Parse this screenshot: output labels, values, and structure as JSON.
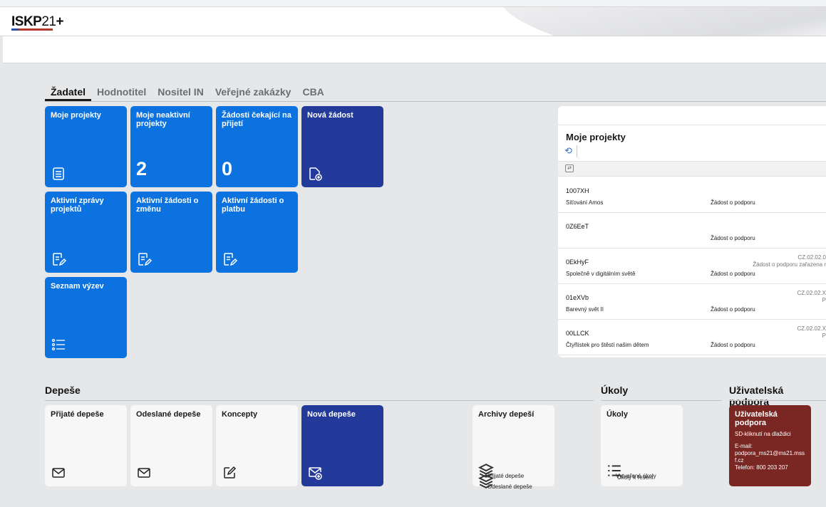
{
  "app": {
    "logo_bold": "ISKP",
    "logo_light": "21",
    "logo_plus": "+"
  },
  "tabs": [
    "Žadatel",
    "Hodnotitel",
    "Nositel IN",
    "Veřejné zakázky",
    "CBA"
  ],
  "tiles": {
    "moje_projekty": "Moje projekty",
    "moje_neaktivni": "Moje neaktivní projekty",
    "moje_neaktivni_count": "2",
    "zadosti_cekajici": "Žádosti čekající na přijetí",
    "zadosti_cekajici_count": "0",
    "nova_zadost": "Nová žádost",
    "aktivni_zpravy": "Aktivní zprávy projektů",
    "aktivni_zmena": "Aktivní žádosti o změnu",
    "aktivni_platba": "Aktivní žádosti o platbu",
    "seznam_vyzev": "Seznam výzev"
  },
  "panel": {
    "title": "Moje projekty",
    "rows": [
      {
        "code": "1007XH",
        "name": "Síťování Amos",
        "type": "Žádost o podporu",
        "reg": "",
        "status": ""
      },
      {
        "code": "0Z6EeT",
        "name": "",
        "type": "Žádost o podporu",
        "reg": "",
        "status": ""
      },
      {
        "code": "0EkHyF",
        "name": "Společně v digitálním světě",
        "type": "Žádost o podporu",
        "reg": "CZ.02.02.0",
        "status": "Žádost o podporu zařazena r"
      },
      {
        "code": "01eXVb",
        "name": "Barevný svět II",
        "type": "Žádost o podporu",
        "reg": "CZ.02.02.X",
        "status": "P"
      },
      {
        "code": "00LLCK",
        "name": "Čtyřlístek pro štěstí našim dětem",
        "type": "Žádost o podporu",
        "reg": "CZ.02.02.X",
        "status": "P"
      }
    ]
  },
  "sections": {
    "depese": "Depeše",
    "ukoly": "Úkoly",
    "podpora": "Uživatelská podpora"
  },
  "depese": {
    "prijate": "Přijaté depeše",
    "odeslane": "Odeslané depeše",
    "koncepty": "Koncepty",
    "nova": "Nová depeše",
    "archivy": "Archivy depeší",
    "archivy_items": [
      "Přijaté depeše",
      "Odeslané depeše"
    ]
  },
  "ukoly": {
    "title": "Úkoly",
    "items": [
      "Vytvořené úkoly",
      "Úkoly k řešení"
    ]
  },
  "podpora": {
    "title": "Uživatelská podpora",
    "subtitle": "SD-kliknutí na dlaždici",
    "email_label": "E-mail:",
    "email": "podpora_ms21@ms21.mssf.cz",
    "phone": "Telefon: 800 203 207"
  },
  "colors": {
    "tile_blue": "#0b72e0",
    "tile_navy": "#233a9b",
    "tile_red": "#7a2622"
  }
}
